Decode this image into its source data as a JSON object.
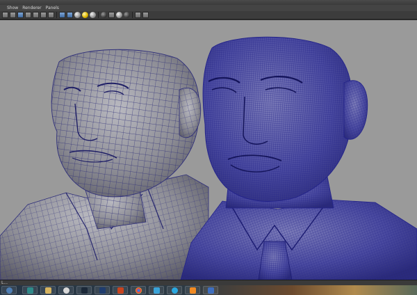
{
  "menu": {
    "items": [
      "Show",
      "Renderer",
      "Panels"
    ]
  },
  "toolbar": {
    "icons": [
      "camera-select-icon",
      "camera-attributes-icon",
      "bookmark-icon",
      "image-plane-icon",
      "grid-icon",
      "film-gate-icon",
      "resolution-gate-icon",
      "safe-action-icon",
      "wireframe-icon",
      "smooth-shade-icon",
      "textured-icon",
      "use-lights-icon",
      "shadows-icon",
      "xray-icon",
      "isolate-select-icon",
      "ambient-occlusion-icon",
      "anti-alias-icon",
      "depth-of-field-icon"
    ]
  },
  "status": {
    "text": "L..."
  },
  "colors": {
    "viewport_bg": "#9a9a9a",
    "wire_low": "#2e2e7a",
    "wire_high": "#22228a",
    "mesh_surface": "#8f8f8f"
  },
  "taskbar": {
    "apps": [
      "start-orb-icon",
      "maya-icon",
      "explorer-icon",
      "media-player-icon",
      "steam-icon",
      "photoshop-icon",
      "powerpoint-icon",
      "chrome-icon",
      "snipping-icon",
      "skype-icon",
      "sublime-icon",
      "word-icon"
    ]
  }
}
